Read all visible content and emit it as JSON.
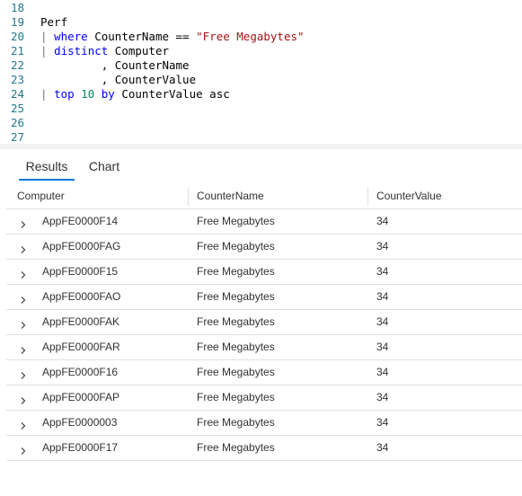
{
  "editor": {
    "lines": [
      {
        "number": "18",
        "tokens": []
      },
      {
        "number": "19",
        "tokens": [
          {
            "t": "plain",
            "v": "Perf"
          }
        ]
      },
      {
        "number": "20",
        "tokens": [
          {
            "t": "pipe",
            "v": "| "
          },
          {
            "t": "kw",
            "v": "where"
          },
          {
            "t": "plain",
            "v": " CounterName == "
          },
          {
            "t": "str",
            "v": "\"Free Megabytes\""
          }
        ]
      },
      {
        "number": "21",
        "tokens": [
          {
            "t": "pipe",
            "v": "| "
          },
          {
            "t": "kw",
            "v": "distinct"
          },
          {
            "t": "plain",
            "v": " Computer"
          }
        ]
      },
      {
        "number": "22",
        "tokens": [
          {
            "t": "plain",
            "v": "         , CounterName"
          }
        ]
      },
      {
        "number": "23",
        "tokens": [
          {
            "t": "plain",
            "v": "         , CounterValue"
          }
        ]
      },
      {
        "number": "24",
        "tokens": [
          {
            "t": "pipe",
            "v": "| "
          },
          {
            "t": "kw",
            "v": "top"
          },
          {
            "t": "plain",
            "v": " "
          },
          {
            "t": "num",
            "v": "10"
          },
          {
            "t": "plain",
            "v": " "
          },
          {
            "t": "kw",
            "v": "by"
          },
          {
            "t": "plain",
            "v": " CounterValue asc"
          }
        ]
      },
      {
        "number": "25",
        "tokens": []
      },
      {
        "number": "26",
        "tokens": []
      },
      {
        "number": "27",
        "tokens": []
      }
    ]
  },
  "tabs": {
    "results_label": "Results",
    "chart_label": "Chart",
    "active": "Results"
  },
  "grid": {
    "columns": [
      "Computer",
      "CounterName",
      "CounterValue"
    ],
    "rows": [
      [
        "AppFE0000F14",
        "Free Megabytes",
        "34"
      ],
      [
        "AppFE0000FAG",
        "Free Megabytes",
        "34"
      ],
      [
        "AppFE0000F15",
        "Free Megabytes",
        "34"
      ],
      [
        "AppFE0000FAO",
        "Free Megabytes",
        "34"
      ],
      [
        "AppFE0000FAK",
        "Free Megabytes",
        "34"
      ],
      [
        "AppFE0000FAR",
        "Free Megabytes",
        "34"
      ],
      [
        "AppFE0000F16",
        "Free Megabytes",
        "34"
      ],
      [
        "AppFE0000FAP",
        "Free Megabytes",
        "34"
      ],
      [
        "AppFE0000003",
        "Free Megabytes",
        "34"
      ],
      [
        "AppFE0000F17",
        "Free Megabytes",
        "34"
      ]
    ]
  },
  "icons": {
    "row_expander": "chevron-right-icon"
  },
  "colors": {
    "accent": "#0078d4",
    "keyword": "#0000ff",
    "string": "#a31515",
    "number": "#098658",
    "line_number": "#237893"
  }
}
